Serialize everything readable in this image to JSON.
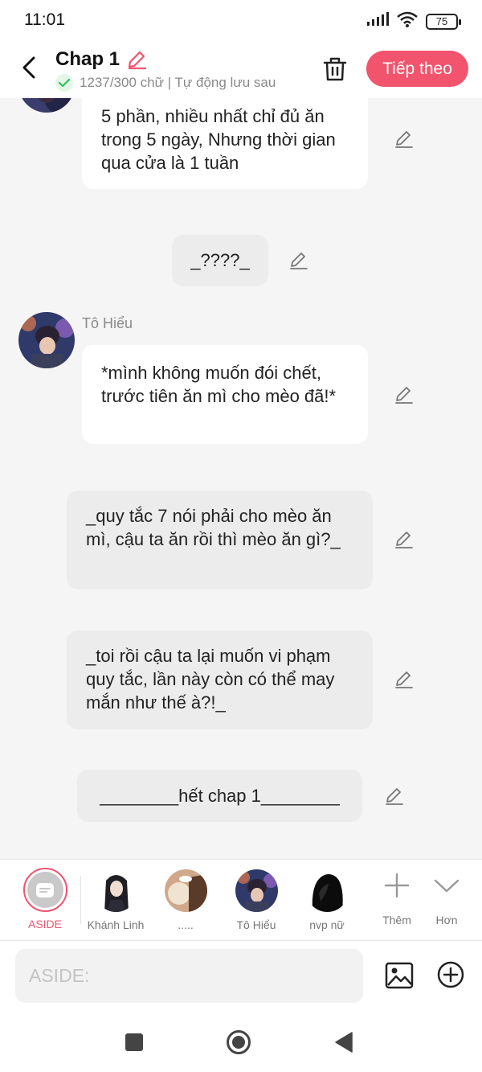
{
  "status_bar": {
    "time": "11:01",
    "battery": "75"
  },
  "header": {
    "title": "Chap 1",
    "save_status": "1237/300 chữ | Tự động lưu sau",
    "next_label": "Tiếp theo"
  },
  "messages": [
    {
      "kind": "character",
      "text": "5 phần, nhiều nhất chỉ đủ ăn trong 5 ngày, Nhưng thời gian qua cửa là 1 tuần"
    },
    {
      "kind": "aside",
      "text": "_????_"
    },
    {
      "kind": "character",
      "speaker": "Tô Hiểu",
      "text": "*mình không muốn đói chết, trước tiên ăn mì cho mèo đã!*"
    },
    {
      "kind": "aside",
      "text": "_quy tắc 7 nói phải cho mèo ăn mì, cậu ta ăn rồi thì mèo ăn gì?_"
    },
    {
      "kind": "aside",
      "text": "_toi rồi cậu ta lại muốn vi phạm quy tắc, lần này còn có thể may mắn như thế à?!_"
    },
    {
      "kind": "aside",
      "text": "________hết chap 1________"
    }
  ],
  "characters": {
    "aside_label": "ASIDE",
    "items": [
      {
        "name": "Khánh Linh"
      },
      {
        "name": "....."
      },
      {
        "name": "Tô Hiểu"
      },
      {
        "name": "nvp nữ"
      }
    ],
    "add_label": "Thêm",
    "more_label": "Hơn"
  },
  "composer": {
    "placeholder": "ASIDE:"
  },
  "colors": {
    "accent": "#f2546e",
    "bubble_white": "#ffffff",
    "bubble_grey": "#ececec",
    "background": "#f5f5f5"
  },
  "icons": {
    "signal": "signal-icon",
    "wifi": "wifi-icon",
    "battery": "battery-icon",
    "back": "back-arrow-icon",
    "edit": "pencil-icon",
    "check": "check-icon",
    "delete": "trash-icon",
    "plus": "plus-icon",
    "chevron": "chevron-down-icon",
    "image": "image-icon",
    "add_circle": "plus-circle-icon",
    "nav_recent": "square-icon",
    "nav_home": "circle-icon",
    "nav_back": "triangle-back-icon"
  }
}
